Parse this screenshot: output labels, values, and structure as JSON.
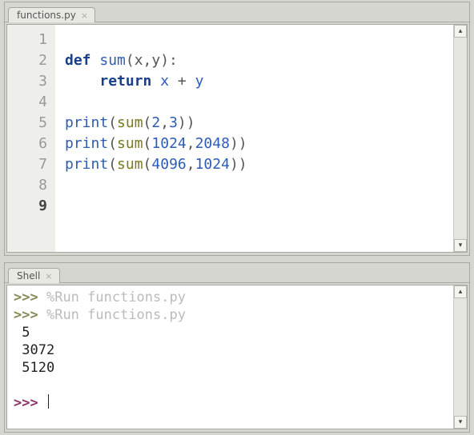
{
  "editor": {
    "tab_title": "functions.py",
    "lines": {
      "count": 9,
      "current": 9
    },
    "code": {
      "l2_def": "def",
      "l2_name": "sum",
      "l2_args": "(x,y):",
      "l3_return": "return",
      "l3_expr_x": "x",
      "l3_expr_plus": " + ",
      "l3_expr_y": "y",
      "l5_print": "print",
      "l5_call": "sum",
      "l5_a": "2",
      "l5_b": "3",
      "l6_print": "print",
      "l6_call": "sum",
      "l6_a": "1024",
      "l6_b": "2048",
      "l7_print": "print",
      "l7_call": "sum",
      "l7_a": "4096",
      "l7_b": "1024"
    }
  },
  "shell": {
    "tab_title": "Shell",
    "prompt": ">>>",
    "run_cmd": "%Run functions.py",
    "history": [
      {
        "prompt": ">>>",
        "text": "%Run functions.py"
      },
      {
        "prompt": ">>>",
        "text": "%Run functions.py"
      }
    ],
    "output": [
      "5",
      "3072",
      "5120"
    ]
  }
}
